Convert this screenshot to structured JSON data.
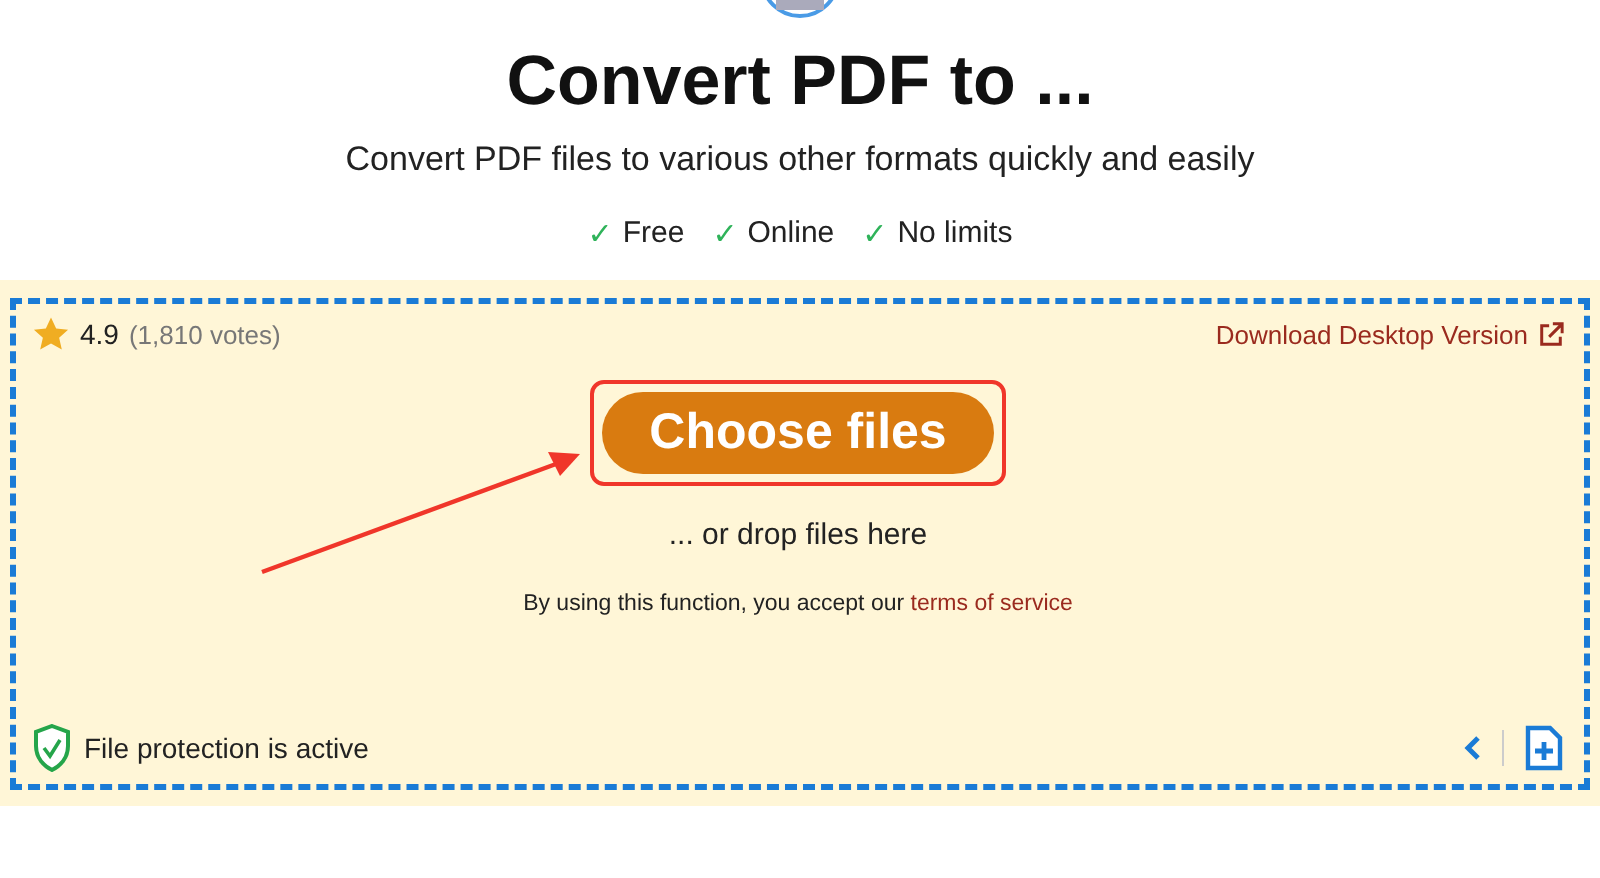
{
  "header": {
    "title": "Convert PDF to ...",
    "subtitle": "Convert PDF files to various other formats quickly and easily",
    "features": [
      {
        "mark": "✓",
        "label": "Free"
      },
      {
        "mark": "✓",
        "label": "Online"
      },
      {
        "mark": "✓",
        "label": "No limits"
      }
    ]
  },
  "upload": {
    "rating": "4.9",
    "votes": "(1,810 votes)",
    "download_link": "Download Desktop Version",
    "button": "Choose files",
    "drop_hint": "... or drop files here",
    "terms_text": "By using this function, you accept our",
    "terms_link": "terms of service",
    "protection": "File protection is active"
  }
}
